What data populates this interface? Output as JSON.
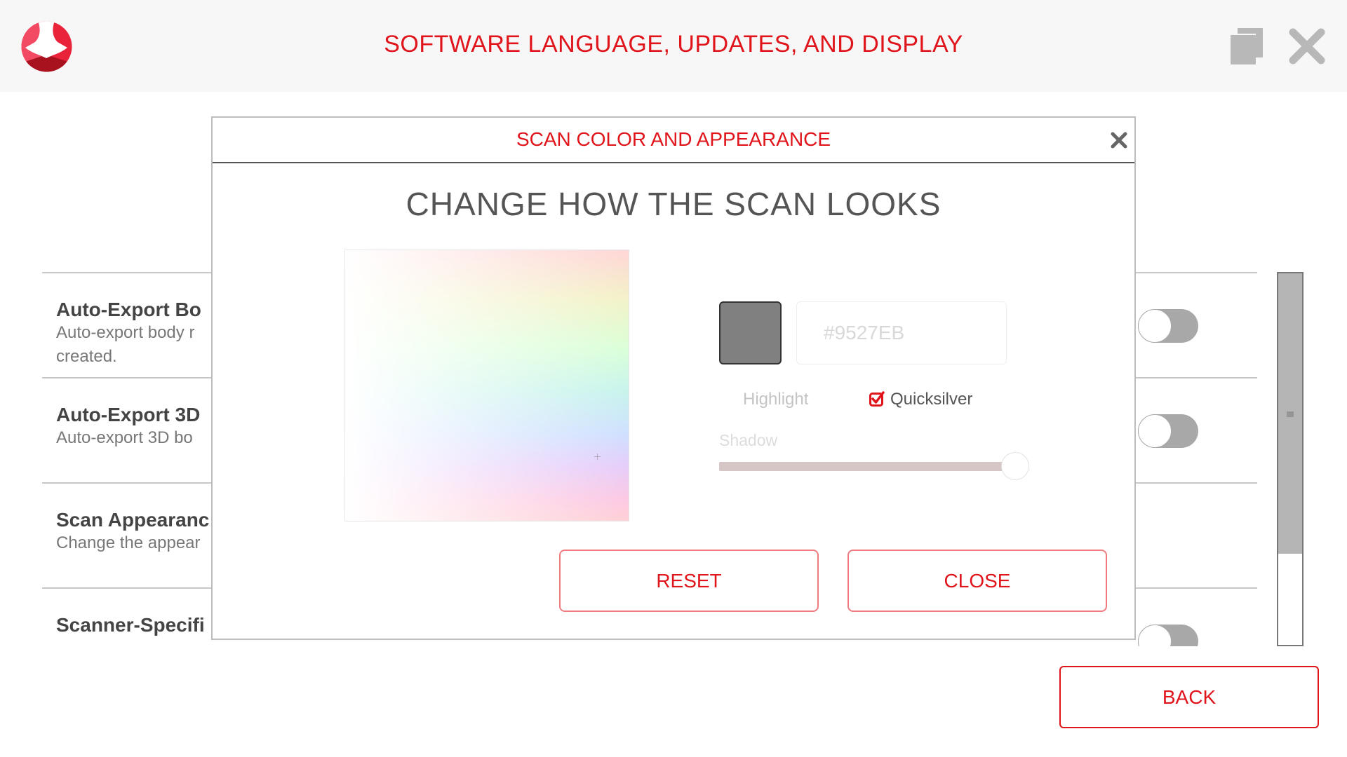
{
  "header": {
    "title": "SOFTWARE LANGUAGE, UPDATES, AND DISPLAY",
    "logo_icon": "app-logo",
    "copy_icon": "copy-windows-icon",
    "exit_icon": "close-x-icon"
  },
  "settings_list": {
    "rows": [
      {
        "title": "Auto-Export Bo",
        "description_lines": [
          "Auto-export body r",
          "created."
        ],
        "toggle_on": false
      },
      {
        "title": "Auto-Export 3D",
        "description_lines": [
          "Auto-export 3D bo"
        ],
        "toggle_on": false
      },
      {
        "title": "Scan Appearanc",
        "description_lines": [
          "Change the appear"
        ]
      },
      {
        "title": "Scanner-Specifi",
        "description_lines": [
          ""
        ],
        "toggle_on": false
      }
    ]
  },
  "scrollbar": {
    "thumb_fraction": 0.75,
    "position_fraction": 0.0,
    "grip_icon": "drag-grip-icon"
  },
  "back_button": {
    "label": "BACK"
  },
  "modal": {
    "title": "SCAN COLOR AND APPEARANCE",
    "close_icon": "close-icon",
    "heading": "CHANGE HOW THE SCAN LOOKS",
    "color_picker": {
      "crosshair_icon": "crosshair-icon"
    },
    "swatch_color": "#808080",
    "hex_input": {
      "value": "",
      "placeholder": "#9527EB"
    },
    "options": {
      "highlight_label": "Highlight",
      "quicksilver_label": "Quicksilver",
      "quicksilver_checked": true
    },
    "shadow": {
      "label": "Shadow",
      "value_percent": 100
    },
    "reset_label": "RESET",
    "close_label": "CLOSE"
  },
  "colors": {
    "accent": "#e0141b",
    "toggle_off": "#a8a8a8",
    "slider_track": "#d7c6c6"
  }
}
